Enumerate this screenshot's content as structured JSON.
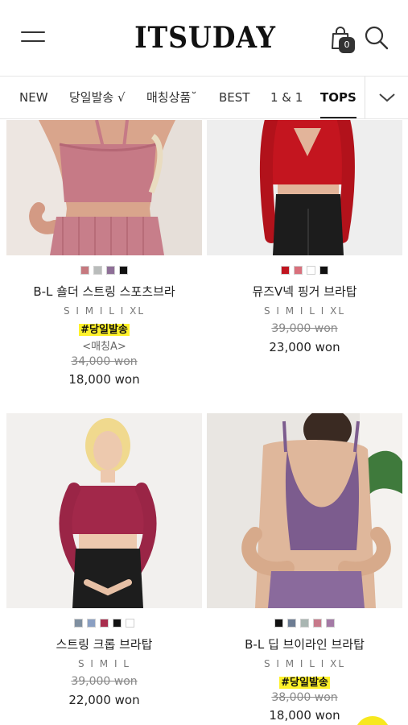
{
  "header": {
    "logo": "ITSUDAY",
    "cart_count": "0"
  },
  "categories": [
    {
      "label": "NEW"
    },
    {
      "label": "당일발송 √"
    },
    {
      "label": "매칭상품˘"
    },
    {
      "label": "BEST"
    },
    {
      "label": "1 & 1"
    },
    {
      "label": "TOPS"
    }
  ],
  "products": [
    {
      "name": "B-L 숄더 스트링 스포츠브라",
      "sizes": "S I M I L I XL",
      "tag": "#당일발송",
      "note": "<매칭A>",
      "original_price": "34,000 won",
      "price": "18,000 won",
      "colors": [
        "#c6797f",
        "#b9bcbb",
        "#8e6f97",
        "#111111"
      ]
    },
    {
      "name": "뮤즈V넥 핑거 브라탑",
      "sizes": "S I M I L I XL",
      "original_price": "39,000 won",
      "price": "23,000 won",
      "colors": [
        "#c0141f",
        "#d9707c",
        "#ffffff",
        "#111111"
      ]
    },
    {
      "name": "스트링 크롭 브라탑",
      "sizes": "S I M I L",
      "original_price": "39,000 won",
      "price": "22,000 won",
      "colors": [
        "#7f8fa0",
        "#8a9fc2",
        "#a82d4d",
        "#111111",
        "#ffffff"
      ]
    },
    {
      "name": "B-L 딥 브이라인 브라탑",
      "sizes": "S I M I L I XL",
      "tag": "#당일발송",
      "original_price": "38,000 won",
      "price": "18,000 won",
      "colors": [
        "#111111",
        "#6d7d93",
        "#a9b6b2",
        "#c7798a",
        "#a47aa6"
      ]
    }
  ]
}
